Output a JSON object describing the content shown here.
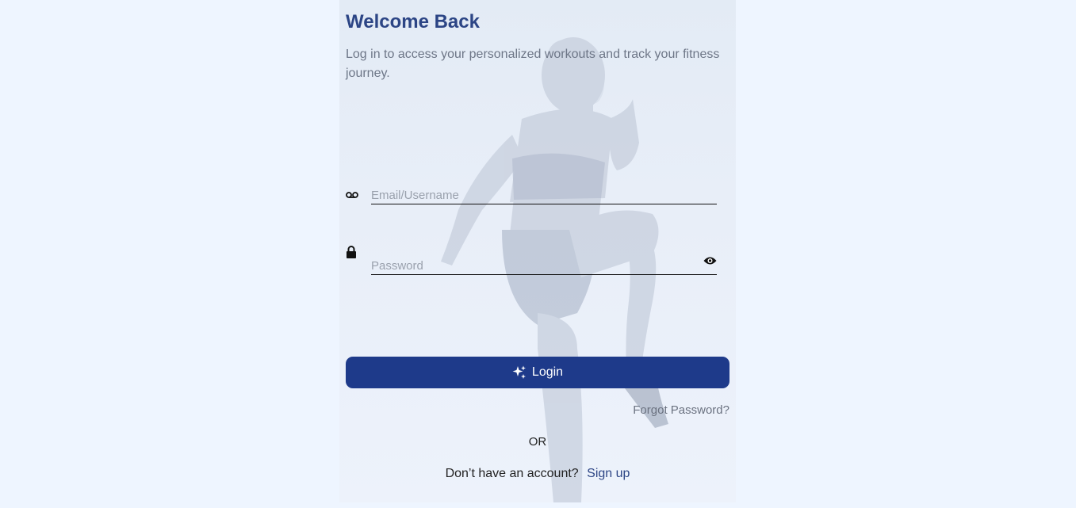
{
  "header": {
    "title": "Welcome Back",
    "subtitle": "Log in to access your personalized workouts and track your fitness journey."
  },
  "form": {
    "email_placeholder": "Email/Username",
    "password_placeholder": "Password",
    "email_icon": "voicemail-icon",
    "password_icon": "lock-icon",
    "visibility_icon": "eye-icon"
  },
  "actions": {
    "login_label": "Login",
    "login_icon": "sparkles-icon",
    "forgot_label": "Forgot Password?",
    "or_label": "OR",
    "signup_prompt": "Don’t have an account?",
    "signup_label": "Sign up"
  },
  "colors": {
    "background": "#eef5ff",
    "accent": "#1e3a8a",
    "title": "#2c4585"
  }
}
